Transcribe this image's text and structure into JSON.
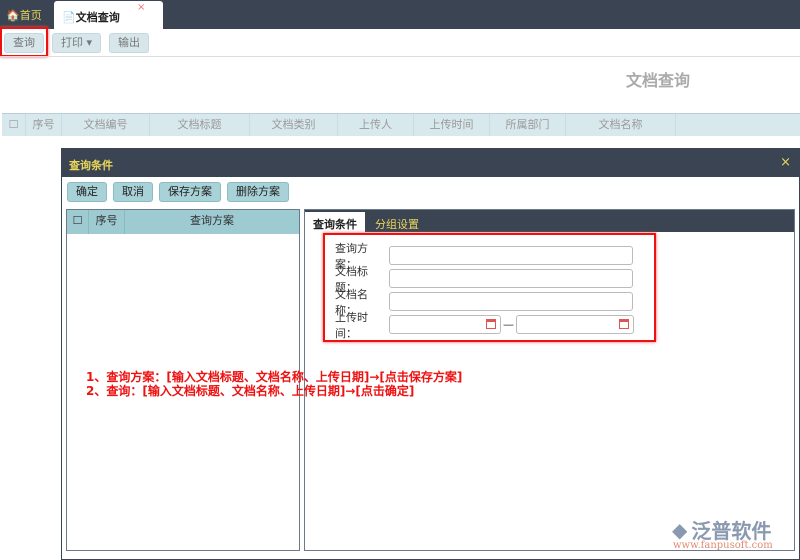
{
  "tabs": {
    "home": "首页",
    "active": "文档查询",
    "close": "×"
  },
  "toolbar": {
    "query": "查询",
    "print": "打印 ▾",
    "export": "输出"
  },
  "page_title": "文档查询",
  "grid_columns": [
    "序号",
    "文档编号",
    "文档标题",
    "文档类别",
    "上传人",
    "上传时间",
    "所属部门",
    "文档名称"
  ],
  "dialog": {
    "title": "查询条件",
    "close": "×",
    "buttons": [
      "确定",
      "取消",
      "保存方案",
      "删除方案"
    ],
    "left_columns": [
      "序号",
      "查询方案"
    ],
    "tabs": [
      "查询条件",
      "分组设置"
    ],
    "fields": [
      "查询方案：",
      "文档标题：",
      "文档名称：",
      "上传时间："
    ],
    "range_sep": "—"
  },
  "notes": [
    "1、查询方案：[输入文档标题、文档名称、上传日期]→[点击保存方案]",
    "2、查询：[输入文档标题、文档名称、上传日期]→[点击确定]"
  ],
  "logo": {
    "name": "泛普软件",
    "url": "www.fanpusoft.com"
  }
}
